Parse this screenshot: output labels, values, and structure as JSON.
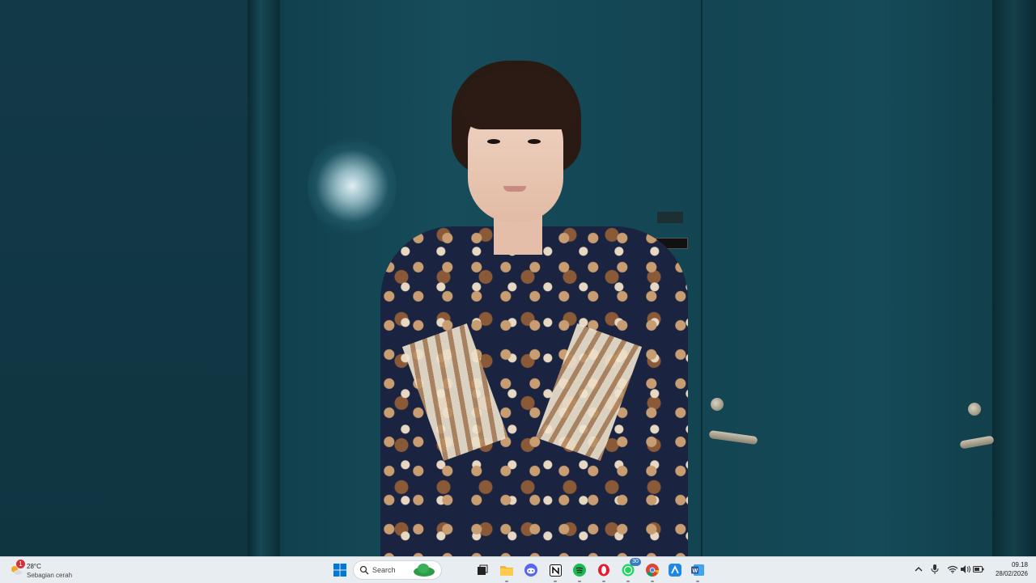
{
  "taskbar": {
    "weather": {
      "temperature": "28°C",
      "condition": "Sebagian cerah",
      "badge": "1"
    },
    "search": {
      "placeholder": "Search"
    },
    "apps": [
      {
        "name": "start",
        "icon": "windows-icon"
      },
      {
        "name": "search",
        "icon": "search-icon"
      },
      {
        "name": "widgets",
        "icon": "cloud-icon"
      },
      {
        "name": "task-view",
        "icon": "task-view-icon"
      },
      {
        "name": "file-explorer",
        "icon": "folder-icon"
      },
      {
        "name": "discord",
        "icon": "discord-icon"
      },
      {
        "name": "notion",
        "icon": "notion-icon"
      },
      {
        "name": "spotify",
        "icon": "spotify-icon"
      },
      {
        "name": "opera",
        "icon": "opera-icon"
      },
      {
        "name": "whatsapp",
        "icon": "whatsapp-icon",
        "badge": "30"
      },
      {
        "name": "chrome",
        "icon": "chrome-icon"
      },
      {
        "name": "arc",
        "icon": "arc-icon"
      },
      {
        "name": "word",
        "icon": "word-icon"
      }
    ],
    "tray": {
      "icons": [
        "chevron-up-icon",
        "microphone-icon",
        "wifi-icon",
        "volume-icon",
        "battery-icon"
      ]
    },
    "clock": {
      "time": "09.18",
      "date": "28/02/2026"
    }
  },
  "colors": {
    "taskbar_bg": "#e8edf1",
    "windows_blue": "#0078d4",
    "spotify_green": "#1db954",
    "whatsapp_green": "#25d366",
    "opera_red": "#e81c2d",
    "discord_blurple": "#5865f2",
    "word_blue": "#2b579a"
  }
}
